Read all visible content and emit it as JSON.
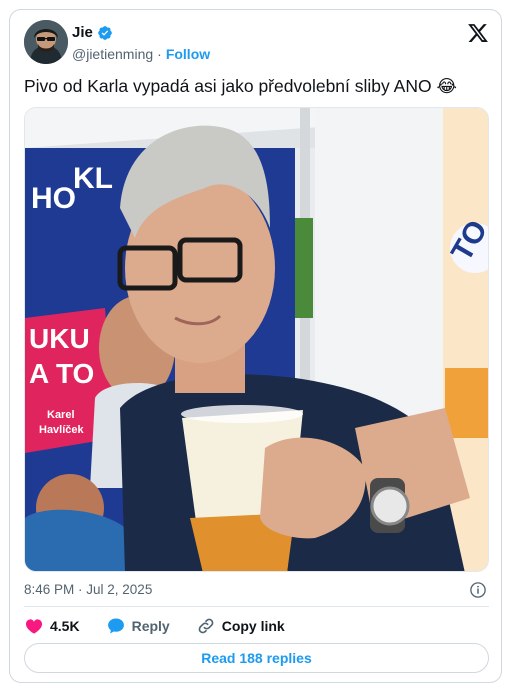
{
  "author": {
    "name": "Jie",
    "handle": "@jietienming",
    "separator": "·",
    "follow_label": "Follow"
  },
  "tweet": {
    "text": "Pivo od Karla vypadá asi jako předvolební sliby ANO 😂",
    "timestamp": "8:46 PM · Jul 2, 2025"
  },
  "photo_text": {
    "banner_left_1": "HO",
    "banner_left_2": "KL",
    "poster_line_1": "UKU",
    "poster_line_2": "A TO",
    "poster_name_1": "Karel",
    "poster_name_2": "Havlíček",
    "right_banner": "TO"
  },
  "actions": {
    "likes": "4.5K",
    "reply_label": "Reply",
    "copy_link_label": "Copy link"
  },
  "replies_button": "Read 188 replies",
  "colors": {
    "accent": "#1d9bf0",
    "like": "#f91880",
    "text": "#0f1419",
    "muted": "#536471",
    "border": "#cfd9de"
  },
  "icons": [
    "verified-badge-icon",
    "x-logo-icon",
    "info-icon",
    "heart-icon",
    "reply-bubble-icon",
    "link-icon"
  ]
}
